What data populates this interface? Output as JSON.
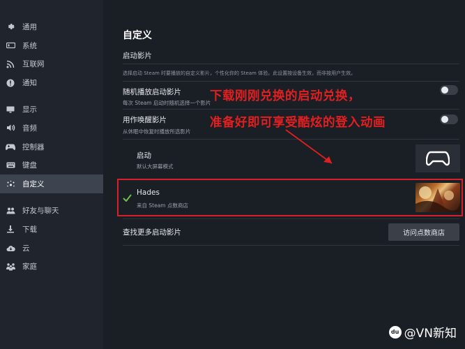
{
  "sidebar": {
    "items": [
      {
        "label": "通用",
        "icon": "gear-icon"
      },
      {
        "label": "系统",
        "icon": "system-icon"
      },
      {
        "label": "互联网",
        "icon": "wifi-icon"
      },
      {
        "label": "通知",
        "icon": "info-icon"
      },
      {
        "label": "显示",
        "icon": "monitor-icon"
      },
      {
        "label": "音频",
        "icon": "speaker-icon"
      },
      {
        "label": "控制器",
        "icon": "gamepad-icon"
      },
      {
        "label": "键盘",
        "icon": "keyboard-icon"
      },
      {
        "label": "自定义",
        "icon": "sparkle-icon"
      },
      {
        "label": "好友与聊天",
        "icon": "friends-icon"
      },
      {
        "label": "下载",
        "icon": "download-icon"
      },
      {
        "label": "云",
        "icon": "cloud-icon"
      },
      {
        "label": "家庭",
        "icon": "family-icon"
      }
    ],
    "active_index": 8
  },
  "main": {
    "title": "自定义",
    "section_title": "启动影片",
    "section_desc": "选择启动 Steam 时要播放的自定义影片，个性化你的 Steam 体验。此设置按设备生效，而非按用户生效。",
    "shuffle": {
      "title": "随机播放启动影片",
      "desc": "每次 Steam 启动时随机选择一个影片",
      "on": false
    },
    "wake": {
      "title": "用作唤醒影片",
      "desc": "从休眠中恢复时播放所选影片",
      "on": false
    },
    "movies": [
      {
        "title": "启动",
        "desc": "默认大屏幕模式",
        "selected": false
      },
      {
        "title": "Hades",
        "desc": "来自 Steam 点数商店",
        "selected": true
      }
    ],
    "find_more": "查找更多启动影片",
    "visit_button": "访问点数商店"
  },
  "annotation": {
    "line1": "下载刚刚兑换的启动兑换，",
    "line2": "准备好即可享受酷炫的登入动画",
    "color": "#e02020"
  },
  "watermark": {
    "text": "@VN新知",
    "logo_text": "du"
  },
  "colors": {
    "accent_red": "#d8202a",
    "active_bg": "#3d4450",
    "check_green": "#6fbf4a"
  }
}
